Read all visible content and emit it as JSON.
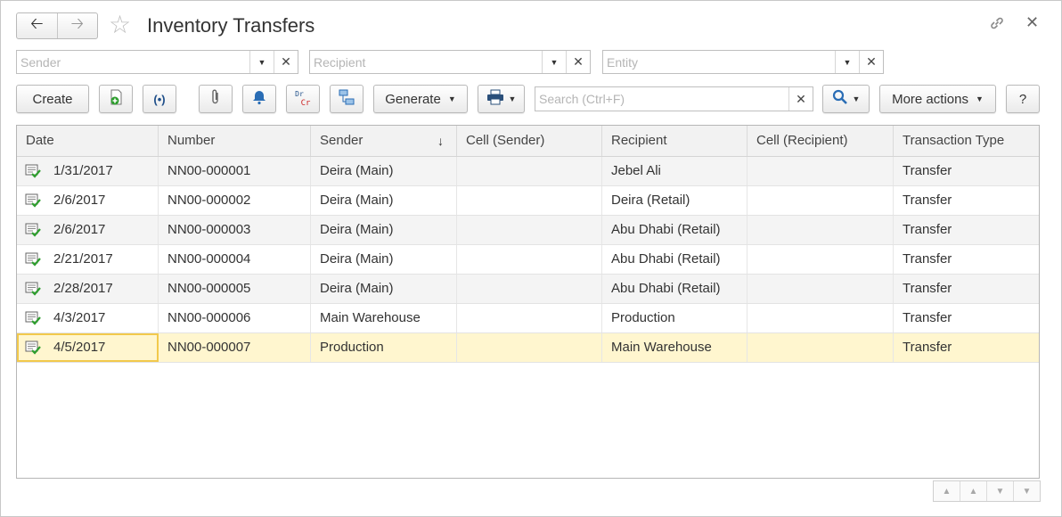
{
  "window": {
    "title": "Inventory Transfers"
  },
  "filters": {
    "sender_placeholder": "Sender",
    "recipient_placeholder": "Recipient",
    "entity_placeholder": "Entity"
  },
  "toolbar": {
    "create_label": "Create",
    "generate_label": "Generate",
    "search_placeholder": "Search (Ctrl+F)",
    "more_actions_label": "More actions",
    "help_label": "?",
    "drcr_dr": "Dr",
    "drcr_cr": "Cr"
  },
  "table": {
    "columns": [
      "Date",
      "Number",
      "Sender",
      "Cell (Sender)",
      "Recipient",
      "Cell (Recipient)",
      "Transaction Type"
    ],
    "rows": [
      {
        "date": "1/31/2017",
        "number": "NN00-000001",
        "sender": "Deira (Main)",
        "cell_sender": "",
        "recipient": "Jebel Ali",
        "cell_recipient": "",
        "type": "Transfer"
      },
      {
        "date": "2/6/2017",
        "number": "NN00-000002",
        "sender": "Deira (Main)",
        "cell_sender": "",
        "recipient": "Deira (Retail)",
        "cell_recipient": "",
        "type": "Transfer"
      },
      {
        "date": "2/6/2017",
        "number": "NN00-000003",
        "sender": "Deira (Main)",
        "cell_sender": "",
        "recipient": "Abu Dhabi (Retail)",
        "cell_recipient": "",
        "type": "Transfer"
      },
      {
        "date": "2/21/2017",
        "number": "NN00-000004",
        "sender": "Deira (Main)",
        "cell_sender": "",
        "recipient": "Abu Dhabi (Retail)",
        "cell_recipient": "",
        "type": "Transfer"
      },
      {
        "date": "2/28/2017",
        "number": "NN00-000005",
        "sender": "Deira (Main)",
        "cell_sender": "",
        "recipient": "Abu Dhabi (Retail)",
        "cell_recipient": "",
        "type": "Transfer"
      },
      {
        "date": "4/3/2017",
        "number": "NN00-000006",
        "sender": "Main Warehouse",
        "cell_sender": "",
        "recipient": "Production",
        "cell_recipient": "",
        "type": "Transfer"
      },
      {
        "date": "4/5/2017",
        "number": "NN00-000007",
        "sender": "Production",
        "cell_sender": "",
        "recipient": "Main Warehouse",
        "cell_recipient": "",
        "type": "Transfer"
      }
    ],
    "selected_row": 6,
    "sorted_column": "Sender"
  },
  "colors": {
    "selected_row": "#fff6cf",
    "focus_border": "#f2c94c",
    "doc_icon_check": "#2e9e2e",
    "drcr_red": "#cc2222",
    "search_icon": "#2a6db5"
  }
}
